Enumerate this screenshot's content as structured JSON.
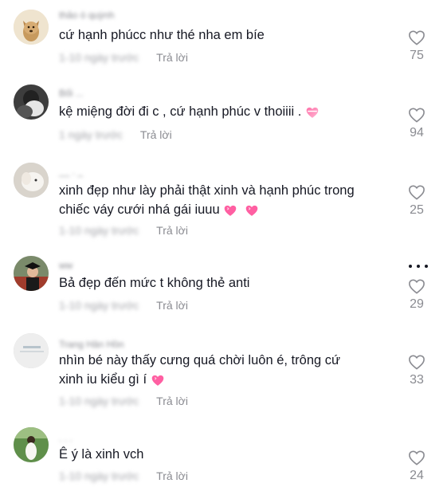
{
  "comments": [
    {
      "username": "thảo ó quỳnh",
      "text": "cứ hạnh phúcc như thé nha em bíe",
      "date": "1-10 ngày trước",
      "reply": "Trả lời",
      "likes": "75",
      "avatar_icon": "dog-avatar"
    },
    {
      "username": "Bối ...",
      "text": "kệ miệng đời đi c , cứ hạnh phúc v thoiiii .",
      "date": "1 ngày trước",
      "reply": "Trả lời",
      "likes": "94",
      "avatar_icon": "dark-avatar"
    },
    {
      "username": "__ . _",
      "text_line1": "xinh đẹp như lày phải thật xinh và hạnh phúc trong",
      "text_line2": "chiếc váy cưới nhá gái iuuu",
      "date": "1-10 ngày trước",
      "reply": "Trả lời",
      "likes": "25",
      "avatar_icon": "white-animal-avatar"
    },
    {
      "username": "ww",
      "text": "Bả đẹp đến mức t không thẻ anti",
      "date": "1-10 ngày trước",
      "reply": "Trả lời",
      "likes": "29",
      "avatar_icon": "graduation-avatar"
    },
    {
      "username": "Trang Hân Hồn",
      "text_line1": "nhìn bé này thấy cưng quá chời luôn é, trông cứ",
      "text_line2": "xinh iu kiểu gì í",
      "date": "1-10 ngày trước",
      "reply": "Trả lời",
      "likes": "33",
      "avatar_icon": "light-avatar"
    },
    {
      "username": ". . .",
      "text": "Ê ý là xinh vch",
      "date": "1-10 ngày trước",
      "reply": "Trả lời",
      "likes": "24",
      "avatar_icon": "green-field-avatar"
    }
  ],
  "colors": {
    "text": "#161823",
    "muted": "#8a8b91",
    "heart_emoji": "#fe2c55"
  }
}
